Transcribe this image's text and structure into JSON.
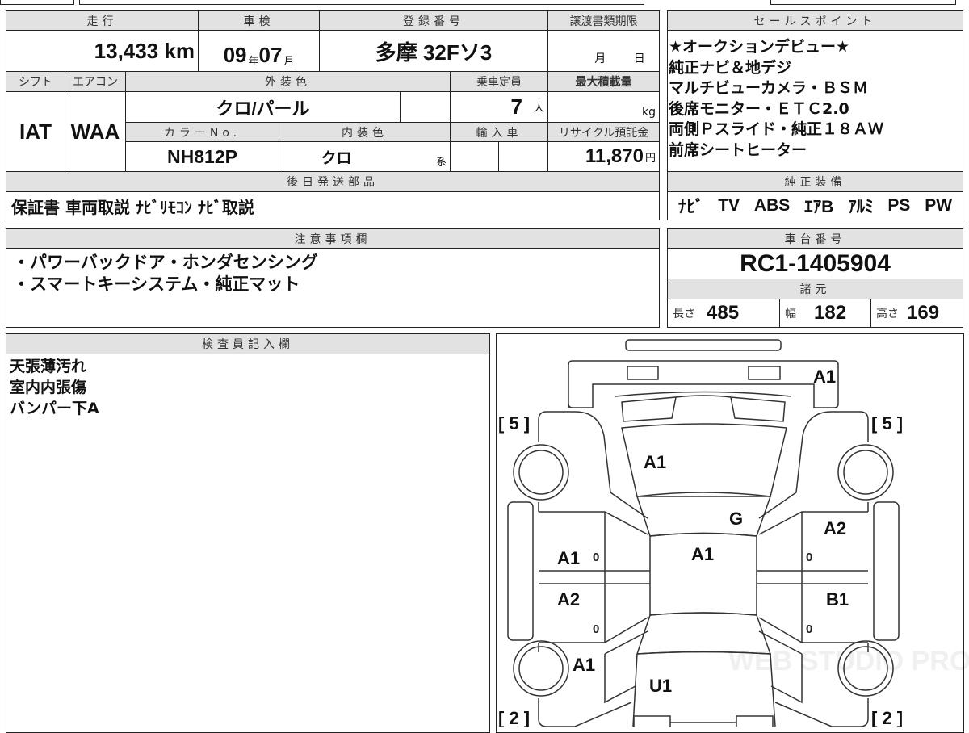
{
  "main": {
    "mileage": {
      "label": "走行",
      "value": "13,433",
      "unit": "km"
    },
    "inspection": {
      "label": "車検",
      "year": "09",
      "year_unit": "年",
      "month": "07",
      "month_unit": "月"
    },
    "registration": {
      "label": "登録番号",
      "value": "多摩 32Fソ3"
    },
    "transfer_deadline": {
      "label": "譲渡書類期限",
      "month_unit": "月",
      "day_unit": "日"
    },
    "shift": {
      "label": "シフト",
      "value": "IAT"
    },
    "aircon": {
      "label": "エアコン",
      "value": "WAA"
    },
    "exterior_color": {
      "label": "外装色",
      "value": "クロ/パール"
    },
    "capacity": {
      "label": "乗車定員",
      "value": "7",
      "unit": "人"
    },
    "max_load": {
      "label": "最大積載量",
      "unit": "kg"
    },
    "color_no": {
      "label": "カラーNo.",
      "value": "NH812P"
    },
    "interior_color": {
      "label": "内装色",
      "value": "クロ",
      "suffix": "系"
    },
    "import": {
      "label": "輸入車"
    },
    "recycle_fee": {
      "label": "リサイクル預託金",
      "value": "11,870",
      "unit": "円"
    },
    "later_parts": {
      "label": "後日発送部品",
      "value": "保証書 車両取説 ﾅﾋﾞﾘﾓｺﾝ ﾅﾋﾞ取説"
    }
  },
  "sales_points": {
    "label": "セールスポイント",
    "lines": [
      "★オークションデビュー★",
      "純正ナビ＆地デジ",
      "マルチビューカメラ・ＢＳＭ",
      "後席モニター・ＥＴＣ2.0",
      "両側Ｐスライド・純正１８ＡＷ",
      "前席シートヒーター"
    ]
  },
  "equipment": {
    "label": "純正装備",
    "items": [
      "ﾅﾋﾞ",
      "TV",
      "ABS",
      "ｴｱB",
      "ｱﾙﾐ",
      "PS",
      "PW"
    ]
  },
  "notes": {
    "label": "注意事項欄",
    "lines": [
      "・パワーバックドア・ホンダセンシング",
      "・スマートキーシステム・純正マット"
    ]
  },
  "chassis": {
    "label": "車台番号",
    "value": "RC1-1405904"
  },
  "specs": {
    "label": "諸元",
    "length_label": "長さ",
    "length": "485",
    "width_label": "幅",
    "width": "182",
    "height_label": "高さ",
    "height": "169"
  },
  "inspector": {
    "label": "検査員記入欄",
    "lines": [
      "天張薄汚れ",
      "室内内張傷",
      "バンパー下A"
    ]
  },
  "diagram": {
    "marks": {
      "rear_bumper": "A1",
      "rear_glass": "A1",
      "roof_front": "G",
      "roof": "A1",
      "left_rear_door": "A1",
      "left_front_door": "A2",
      "right_rear_door": "A2",
      "right_front_door": "B1",
      "left_front_fender": "A1",
      "hood": "U1",
      "door_counts": [
        "0",
        "0",
        "0",
        "0"
      ]
    },
    "tire_rear_left": "[ 5 ]",
    "tire_rear_right": "[ 5 ]",
    "tire_front_left": "[ 2 ]",
    "tire_front_right": "[ 2 ]",
    "watermark": "WEB STUDIO PRO"
  }
}
